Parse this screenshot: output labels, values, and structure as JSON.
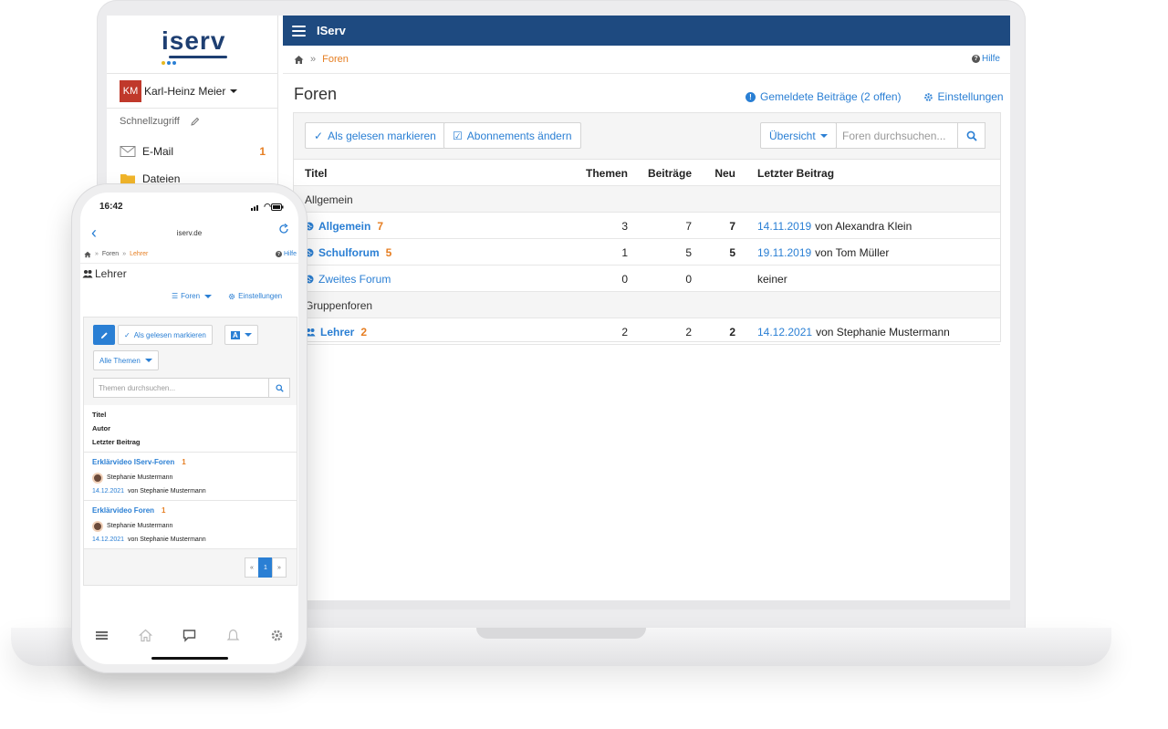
{
  "colors": {
    "topbar": "#1e4a80",
    "link": "#2a7fd4",
    "accent": "#e67e22",
    "avatar": "#c0392b"
  },
  "desktop": {
    "logo": "iserv",
    "app_title": "IServ",
    "user": {
      "initials": "KM",
      "name": "Karl-Heinz Meier"
    },
    "quick_access": "Schnellzugriff",
    "sidebar_items": [
      {
        "label": "E-Mail",
        "icon": "mail-icon",
        "badge": "1"
      },
      {
        "label": "Dateien",
        "icon": "folder-icon",
        "badge": ""
      }
    ],
    "breadcrumb": {
      "current": "Foren"
    },
    "help": "Hilfe",
    "page_title": "Foren",
    "header_links": {
      "reported": "Gemeldete Beiträge (2 offen)",
      "settings": "Einstellungen"
    },
    "toolbar": {
      "mark_read": "Als gelesen markieren",
      "subscriptions": "Abonnements ändern",
      "view_select": "Übersicht",
      "search_placeholder": "Foren durchsuchen..."
    },
    "table": {
      "headers": {
        "title": "Titel",
        "topics": "Themen",
        "posts": "Beiträge",
        "new": "Neu",
        "last": "Letzter Beitrag"
      },
      "groups": [
        {
          "name": "Allgemein",
          "rows": [
            {
              "title": "Allgemein",
              "count": "7",
              "topics": "3",
              "posts": "7",
              "new": "7",
              "date": "14.11.2019",
              "by": "von Alexandra Klein"
            },
            {
              "title": "Schulforum",
              "count": "5",
              "topics": "1",
              "posts": "5",
              "new": "5",
              "date": "19.11.2019",
              "by": "von Tom Müller"
            },
            {
              "title": "Zweites Forum",
              "count": "",
              "topics": "0",
              "posts": "0",
              "new": "",
              "date": "",
              "by": "keiner"
            }
          ]
        },
        {
          "name": "Gruppenforen",
          "rows": [
            {
              "title": "Lehrer",
              "count": "2",
              "topics": "2",
              "posts": "2",
              "new": "2",
              "date": "14.12.2021",
              "by": "von Stephanie Mustermann"
            }
          ]
        }
      ]
    }
  },
  "phone": {
    "time": "16:42",
    "host": "iserv.de",
    "breadcrumb": {
      "parent": "Foren",
      "current": "Lehrer"
    },
    "help": "Hilfe",
    "title": "Lehrer",
    "links": {
      "forums": "Foren",
      "settings": "Einstellungen"
    },
    "mark_read": "Als gelesen markieren",
    "sort_label": "A",
    "filter": "Alle Themen",
    "search_placeholder": "Themen durchsuchen...",
    "columns": [
      "Titel",
      "Autor",
      "Letzter Beitrag"
    ],
    "topics": [
      {
        "title": "Erklärvideo IServ-Foren",
        "count": "1",
        "author": "Stephanie Mustermann",
        "date": "14.12.2021",
        "by": "von Stephanie Mustermann"
      },
      {
        "title": "Erklärvideo Foren",
        "count": "1",
        "author": "Stephanie Mustermann",
        "date": "14.12.2021",
        "by": "von Stephanie Mustermann"
      }
    ],
    "pager": {
      "prev": "«",
      "page": "1",
      "next": "»"
    }
  }
}
